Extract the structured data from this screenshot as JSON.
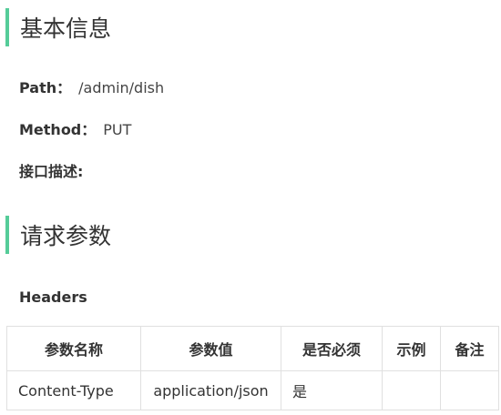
{
  "basic_info": {
    "title": "基本信息",
    "path_label": "Path：",
    "path_value": "/admin/dish",
    "method_label": "Method：",
    "method_value": "PUT",
    "description_label": "接口描述:"
  },
  "request_params": {
    "title": "请求参数",
    "headers_label": "Headers",
    "headers_table": {
      "columns": [
        "参数名称",
        "参数值",
        "是否必须",
        "示例",
        "备注"
      ],
      "rows": [
        [
          "Content-Type",
          "application/json",
          "是",
          "",
          ""
        ]
      ]
    }
  },
  "colors": {
    "accent": "#55cc99",
    "text": "#333333",
    "border": "#e0e0e0"
  }
}
